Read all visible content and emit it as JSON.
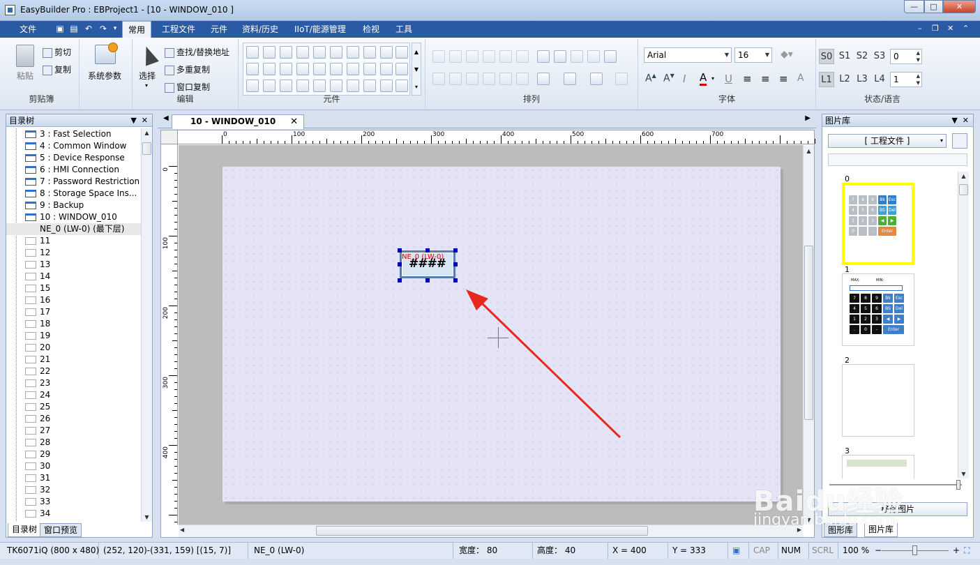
{
  "window": {
    "title": "EasyBuilder Pro : EBProject1 - [10 - WINDOW_010 ]"
  },
  "menu": {
    "items": [
      "文件",
      "常用",
      "工程文件",
      "元件",
      "资料/历史",
      "IIoT/能源管理",
      "检视",
      "工具"
    ],
    "active": "常用"
  },
  "ribbon": {
    "clipboard": {
      "paste": "粘贴",
      "cut": "剪切",
      "copy": "复制",
      "label": "剪贴簿"
    },
    "system": {
      "sysparams": "系统参数"
    },
    "edit": {
      "select": "选择",
      "find_replace": "查找/替换地址",
      "multi_copy": "多重复制",
      "window_copy": "窗口复制",
      "label": "编辑"
    },
    "objects": {
      "label": "元件"
    },
    "arrange": {
      "label": "排列"
    },
    "font": {
      "family": "Arial",
      "size": "16",
      "label": "字体"
    },
    "state": {
      "s0": "S0",
      "s1": "S1",
      "s2": "S2",
      "s3": "S3",
      "state_value": "0",
      "l1": "L1",
      "l2": "L2",
      "l3": "L3",
      "l4": "L4",
      "lang_value": "1",
      "label": "状态/语言"
    }
  },
  "tree": {
    "title": "目录树",
    "items": [
      {
        "label": "3 : Fast Selection"
      },
      {
        "label": "4 : Common Window"
      },
      {
        "label": "5 : Device Response"
      },
      {
        "label": "6 : HMI Connection"
      },
      {
        "label": "7 : Password Restriction"
      },
      {
        "label": "8 : Storage Space Ins..."
      },
      {
        "label": "9 : Backup"
      },
      {
        "label": "10 : WINDOW_010"
      },
      {
        "label": "NE_0 (LW-0) (最下层)"
      },
      {
        "label": "11"
      },
      {
        "label": "12"
      },
      {
        "label": "13"
      },
      {
        "label": "14"
      },
      {
        "label": "15"
      },
      {
        "label": "16"
      },
      {
        "label": "17"
      },
      {
        "label": "18"
      },
      {
        "label": "19"
      },
      {
        "label": "20"
      },
      {
        "label": "21"
      },
      {
        "label": "22"
      },
      {
        "label": "23"
      },
      {
        "label": "24"
      },
      {
        "label": "25"
      },
      {
        "label": "26"
      },
      {
        "label": "27"
      },
      {
        "label": "28"
      },
      {
        "label": "29"
      },
      {
        "label": "30"
      },
      {
        "label": "31"
      },
      {
        "label": "32"
      },
      {
        "label": "33"
      },
      {
        "label": "34"
      }
    ],
    "tabs": [
      "目录树",
      "窗口预览"
    ]
  },
  "document": {
    "tab_label": "10 - WINDOW_010",
    "ruler_h": [
      "0",
      "100",
      "200",
      "300",
      "400",
      "500",
      "600",
      "700"
    ],
    "ruler_v": [
      "0",
      "100",
      "200",
      "300",
      "400"
    ],
    "object": {
      "label": "NE_0 (LW-0)",
      "display": "####"
    }
  },
  "library": {
    "title": "图片库",
    "source": "[ 工程文件 ]",
    "items": [
      "0",
      "1",
      "2",
      "3"
    ],
    "keypad0": [
      "7",
      "8",
      "9",
      "Bk",
      "Esc",
      "4",
      "5",
      "6",
      "BS",
      "Del",
      "1",
      "2",
      "3",
      "◀",
      "▶",
      "0",
      ".",
      "-",
      "Enter"
    ],
    "keypad1_labels": [
      "MAX:",
      "MIN:"
    ],
    "keypad1": [
      "7",
      "8",
      "9",
      "Bk",
      "Esc",
      "4",
      "5",
      "6",
      "BS",
      "Del",
      "1",
      "2",
      "3",
      "◀",
      "▶",
      ".",
      "0",
      "-",
      "Enter"
    ],
    "bottom_button": "移除图片",
    "tabs": [
      "图形库",
      "图片库"
    ]
  },
  "status": {
    "model": "TK6071iQ (800 x 480)",
    "coords": "(252, 120)-(331, 159) [(15, 7)]",
    "object": "NE_0 (LW-0)",
    "width": "宽度： 80",
    "height": "高度： 40",
    "x": "X = 400",
    "y": "Y = 333",
    "cap": "CAP",
    "num": "NUM",
    "scrl": "SCRL",
    "zoom": "100 %"
  },
  "watermark": {
    "brand": "Baidu经验",
    "url": "jingyan.baidu.com"
  }
}
